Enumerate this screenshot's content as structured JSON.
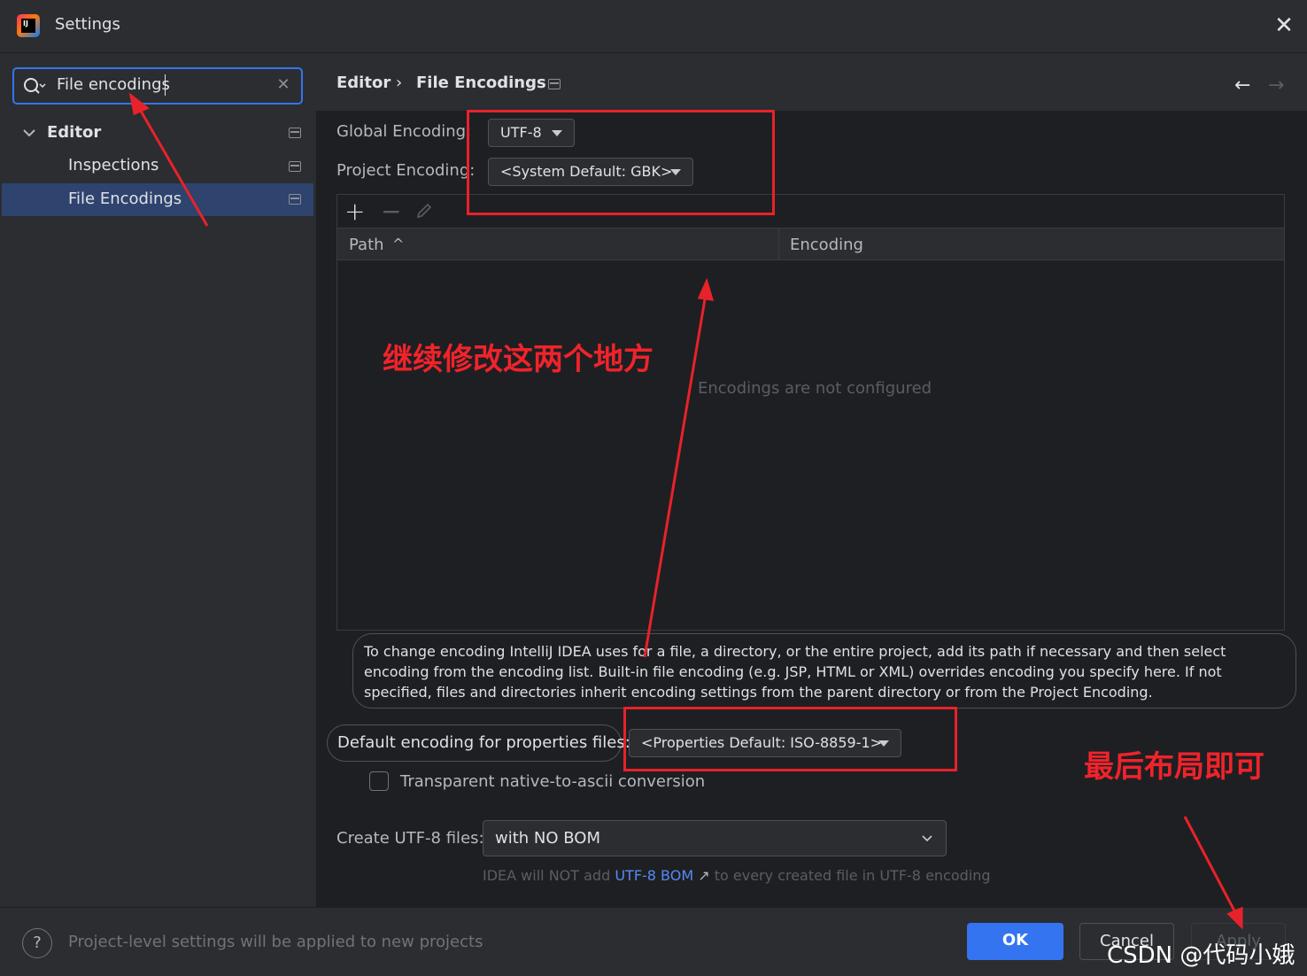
{
  "window": {
    "title": "Settings"
  },
  "sidebar": {
    "search": {
      "value": "File encodings"
    },
    "tree": [
      {
        "label": "Editor"
      },
      {
        "label": "Inspections"
      },
      {
        "label": "File Encodings",
        "selected": true
      }
    ]
  },
  "breadcrumb": {
    "parent": "Editor",
    "separator": "›",
    "current": "File Encodings"
  },
  "encodings": {
    "global_label": "Global Encoding:",
    "global_value": "UTF-8",
    "project_label": "Project Encoding:",
    "project_value": "<System Default: GBK>"
  },
  "table": {
    "columns": [
      "Path",
      "Encoding"
    ],
    "sort_indicator": "^",
    "empty_text": "Encodings are not configured"
  },
  "info": {
    "text": "To change encoding IntelliJ IDEA uses for a file, a directory, or the entire project, add its path if necessary and then select encoding from the encoding list. Built-in file encoding (e.g. JSP, HTML or XML) overrides encoding you specify here. If not specified, files and directories inherit encoding settings from the parent directory or from the Project Encoding."
  },
  "properties": {
    "label": "Default encoding for properties files:",
    "value": "<Properties Default: ISO-8859-1>",
    "transparent_label": "Transparent native-to-ascii conversion",
    "transparent_checked": false
  },
  "utf8": {
    "label": "Create UTF-8 files:",
    "value": "with NO BOM",
    "hint_prefix": "IDEA will NOT add",
    "hint_link": "UTF-8 BOM",
    "hint_arrow": "↗",
    "hint_suffix": "to every created file in UTF-8 encoding"
  },
  "footer": {
    "help": "?",
    "text": "Project-level settings will be applied to new projects",
    "ok": "OK",
    "cancel": "Cancel",
    "apply": "Apply"
  },
  "annotations": {
    "note_middle": "继续修改这两个地方",
    "note_bottom": "最后布局即可",
    "watermark": "CSDN @代码小娥",
    "color": "#e8222a"
  },
  "colors": {
    "accent": "#3574f0",
    "selection": "#2e436e",
    "background": "#1e1f22",
    "panel": "#2b2d30"
  }
}
